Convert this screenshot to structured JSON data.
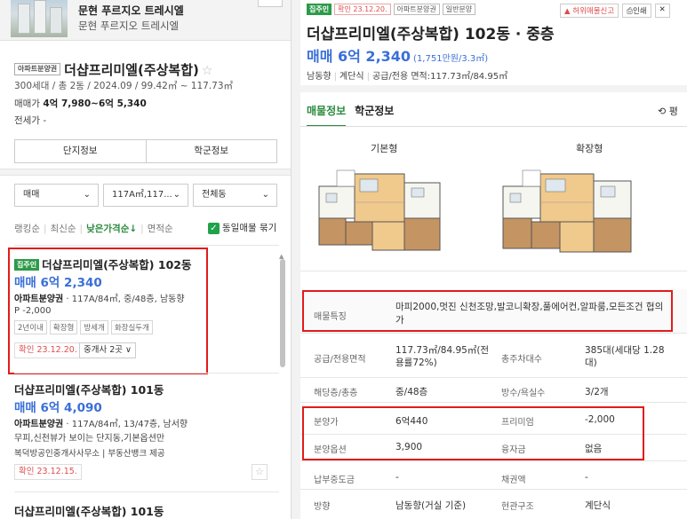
{
  "neighbor_complex": {
    "title": "문현 푸르지오 트레시엘",
    "subtitle": "문현 푸르지오 트레시엘"
  },
  "complex": {
    "type_tag": "아파트분양권",
    "name": "더샵프리미엘(주상복합)",
    "meta": "300세대 / 총 2동 / 2024.09 / 99.42㎡ ~ 117.73㎡",
    "price_label": "매매가",
    "price_value": "4억 7,980~6억 5,340",
    "jeonse_label": "전세가",
    "jeonse_value": "-",
    "tabs": [
      "단지정보",
      "학군정보"
    ]
  },
  "filters": {
    "trade": "매매",
    "area": "117A㎡,117...",
    "building": "전체동"
  },
  "sort": {
    "options": [
      "랭킹순",
      "최신순",
      "낮은가격순↓",
      "면적순"
    ],
    "active_index": 2,
    "group_label": "동일매물 묶기",
    "group_checked": true
  },
  "listings": [
    {
      "badge": "집주인",
      "title": "더샵프리미엘(주상복합) 102동",
      "price": "매매 6억 2,340",
      "desc_type": "아파트분양권",
      "desc": " · 117A/84㎡, 중/48층, 남동향",
      "extra": "P -2,000",
      "chips": [
        "2년이내",
        "확장형",
        "방세개",
        "화장실두개"
      ],
      "confirm": "확인 23.12.20.",
      "brokers": "중개사 2곳 ∨"
    },
    {
      "title": "더샵프리미엘(주상복합) 101동",
      "price": "매매 6억 4,090",
      "desc_type": "아파트분양권",
      "desc": " · 117A/84㎡, 13/47층, 남서향",
      "extra": "무피,신천뷰가 보이는 단지동,기본옵션만",
      "source": "복덕방공인중개사사무소 | 부동산뱅크 제공",
      "confirm": "확인 23.12.15."
    },
    {
      "title": "더샵프리미엘(주상복합) 101동"
    }
  ],
  "detail": {
    "tags": [
      "집주인",
      "확인 23.12.20.",
      "아파트분양권",
      "일반분양"
    ],
    "actions": [
      "허위매물신고",
      "인쇄"
    ],
    "title": "더샵프리미엘(주상복합) 102동 · 중층",
    "price": "매매 6억 2,340",
    "price_unit": "(1,751만원/3.3㎡)",
    "info": [
      "남동향",
      "계단식",
      "공급/전용 면적:117.73㎡/84.95㎡"
    ],
    "tabs": [
      "매물정보",
      "학군정보"
    ],
    "more": "⟲ 평",
    "plans": [
      "기본형",
      "확장형"
    ],
    "table": {
      "feature_label": "매물특징",
      "feature_value": "마피2000,멋진 신천조망,발코니확장,풀에어컨,알파룸,모든조건 협의가",
      "area_label": "공급/전용면적",
      "area_value": "117.73㎡/84.95㎡(전용률72%)",
      "households_label": "총주차대수",
      "households_value": "385대(세대당 1.28대)",
      "floor_label": "해당층/총층",
      "floor_value": "중/48층",
      "rooms_label": "방수/욕실수",
      "rooms_value": "3/2개",
      "sale_price_label": "분양가",
      "sale_price_value": "6억440",
      "premium_label": "프리미엄",
      "premium_value": "-2,000",
      "option_label": "분양옵션",
      "option_value": "3,900",
      "loan_label": "융자금",
      "loan_value": "없음",
      "interim_label": "납부중도금",
      "interim_value": "-",
      "bond_label": "채권액",
      "bond_value": "-",
      "direction_label": "방향",
      "direction_value": "남동향(거실 기준)",
      "entrance_label": "현관구조",
      "entrance_value": "계단식"
    }
  }
}
